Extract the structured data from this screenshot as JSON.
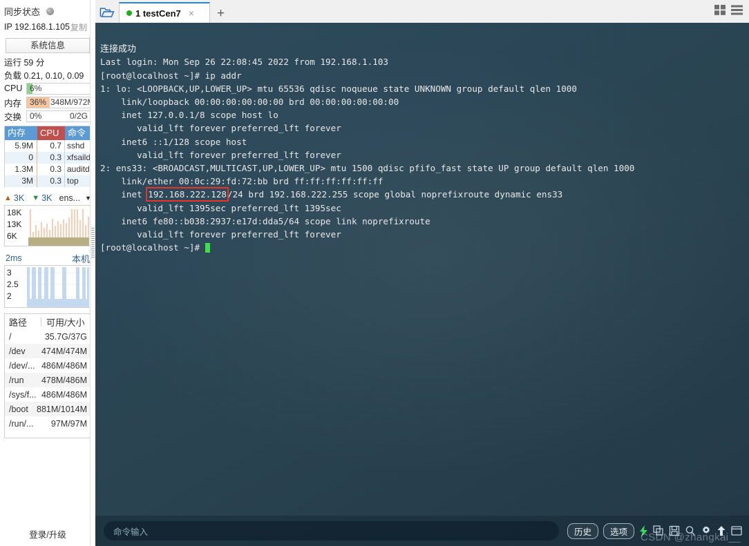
{
  "sidebar": {
    "sync_status_label": "同步状态",
    "ip_label": "IP 192.168.1.105",
    "copy_label": "复制",
    "system_info_button": "系统信息",
    "uptime": "运行 59 分",
    "load": "负载 0.21, 0.10, 0.09",
    "meters": [
      {
        "name": "CPU",
        "left_text": "6%",
        "right_text": "",
        "percent": 6,
        "color": "#8fd18f"
      },
      {
        "name": "内存",
        "left_text": "36%",
        "mid_text": "348M/972M",
        "right_text": "",
        "percent": 36,
        "color": "#f6c6a0"
      },
      {
        "name": "交换",
        "left_text": "0%",
        "right_text": "0/2G",
        "percent": 0,
        "color": "#cfe3f5"
      }
    ],
    "process_table": {
      "headers": [
        "内存",
        "CPU",
        "命令"
      ],
      "rows": [
        {
          "mem": "5.9M",
          "cpu": "0.7",
          "cmd": "sshd"
        },
        {
          "mem": "0",
          "cpu": "0.3",
          "cmd": "xfsaild/d"
        },
        {
          "mem": "1.3M",
          "cpu": "0.3",
          "cmd": "auditd"
        },
        {
          "mem": "3M",
          "cpu": "0.3",
          "cmd": "top"
        }
      ]
    },
    "network": {
      "upload": "3K",
      "download": "3K",
      "interface": "ens...",
      "y_ticks": [
        "18K",
        "13K",
        "6K"
      ]
    },
    "latency": {
      "value": "2ms",
      "location": "本机",
      "y_ticks": [
        "3",
        "2.5",
        "2"
      ]
    },
    "disk_table": {
      "headers": [
        "路径",
        "可用/大小"
      ],
      "rows": [
        {
          "path": "/",
          "size": "35.7G/37G"
        },
        {
          "path": "/dev",
          "size": "474M/474M"
        },
        {
          "path": "/dev/...",
          "size": "486M/486M"
        },
        {
          "path": "/run",
          "size": "478M/486M"
        },
        {
          "path": "/sys/f...",
          "size": "486M/486M"
        },
        {
          "path": "/boot",
          "size": "881M/1014M"
        },
        {
          "path": "/run/...",
          "size": "97M/97M"
        }
      ]
    },
    "login_upgrade": "登录/升级"
  },
  "tabbar": {
    "folder_icon": "folder-open-icon",
    "tabs": [
      {
        "index": "1",
        "label": "1 testCen7",
        "status": "connected",
        "close": "×"
      }
    ],
    "add_tab": "+",
    "grid_icon": "grid-layout-icon",
    "list_icon": "list-layout-icon"
  },
  "terminal": {
    "connect_message": "连接成功",
    "lines": [
      "Last login: Mon Sep 26 22:08:45 2022 from 192.168.1.103",
      "[root@localhost ~]# ip addr",
      "1: lo: <LOOPBACK,UP,LOWER_UP> mtu 65536 qdisc noqueue state UNKNOWN group default qlen 1000",
      "    link/loopback 00:00:00:00:00:00 brd 00:00:00:00:00:00",
      "    inet 127.0.0.1/8 scope host lo",
      "       valid_lft forever preferred_lft forever",
      "    inet6 ::1/128 scope host",
      "       valid_lft forever preferred_lft forever",
      "2: ens33: <BROADCAST,MULTICAST,UP,LOWER_UP> mtu 1500 qdisc pfifo_fast state UP group default qlen 1000",
      "    link/ether 00:0c:29:fd:72:bb brd ff:ff:ff:ff:ff:ff"
    ],
    "inet_line_prefix": "    inet ",
    "inet_highlight": "192.168.222.128",
    "inet_line_suffix": "/24 brd 192.168.222.255 scope global noprefixroute dynamic ens33",
    "lines_after": [
      "       valid_lft 1395sec preferred_lft 1395sec",
      "    inet6 fe80::b038:2937:e17d:dda5/64 scope link noprefixroute",
      "       valid_lft forever preferred_lft forever"
    ],
    "prompt": "[root@localhost ~]# ",
    "highlight_color": "#e8352a"
  },
  "command_bar": {
    "input_placeholder": "命令输入",
    "history_button": "历史",
    "options_button": "选项",
    "icons": [
      "lightning-icon",
      "copy-icon",
      "save-icon",
      "search-icon",
      "gear-icon",
      "upload-icon",
      "window-icon"
    ]
  },
  "watermark": "CSDN @zhangkai__"
}
